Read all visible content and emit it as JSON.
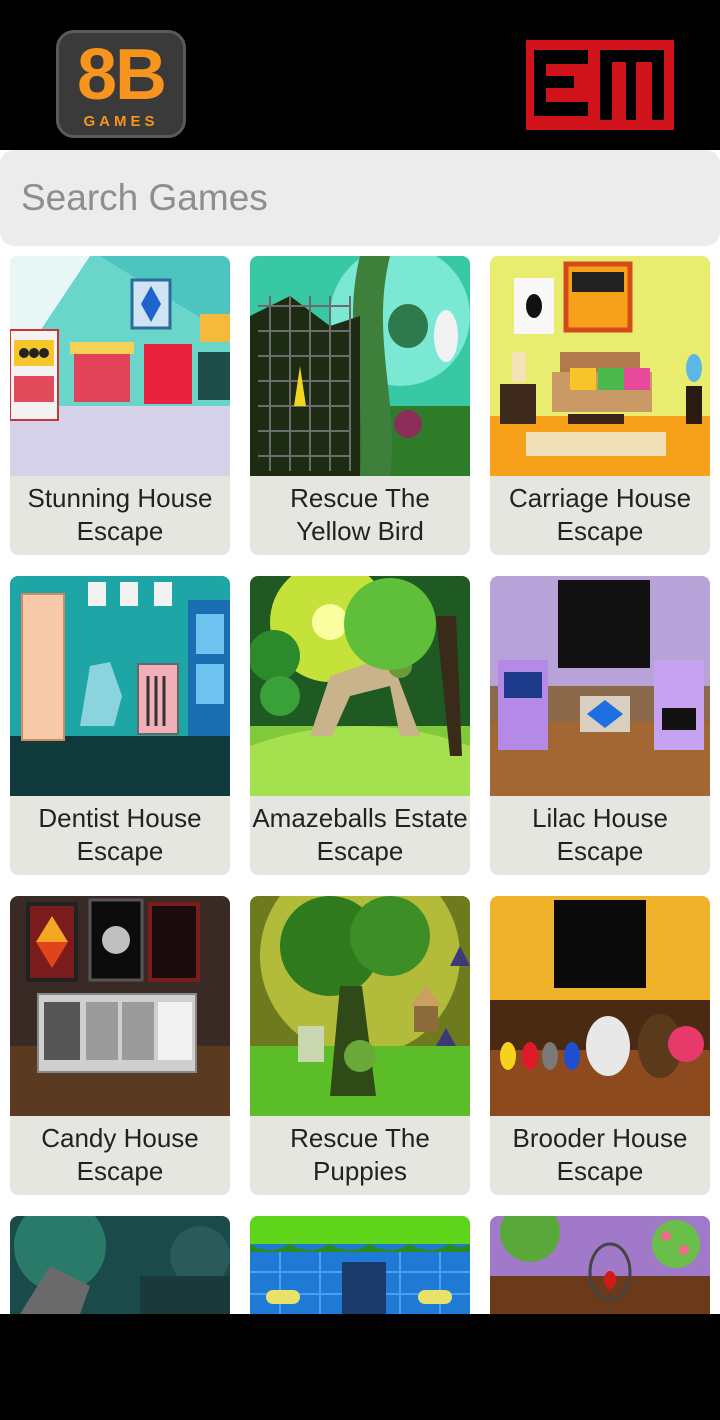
{
  "header": {
    "logo_left": {
      "main": "8B",
      "sub": "GAMES",
      "color": "#f7941d"
    },
    "logo_right": {
      "color": "#d0121b"
    }
  },
  "search": {
    "placeholder": "Search Games",
    "value": ""
  },
  "games": [
    {
      "title": "Stunning House Escape"
    },
    {
      "title": "Rescue The Yellow Bird"
    },
    {
      "title": "Carriage House Escape"
    },
    {
      "title": "Dentist House Escape"
    },
    {
      "title": "Amazeballs Estate Escape"
    },
    {
      "title": "Lilac House Escape"
    },
    {
      "title": "Candy House Escape"
    },
    {
      "title": "Rescue The Puppies"
    },
    {
      "title": "Brooder House Escape"
    }
  ],
  "colors": {
    "background": "#ffffff",
    "card": "#e6e6e0",
    "bar": "#000000"
  }
}
